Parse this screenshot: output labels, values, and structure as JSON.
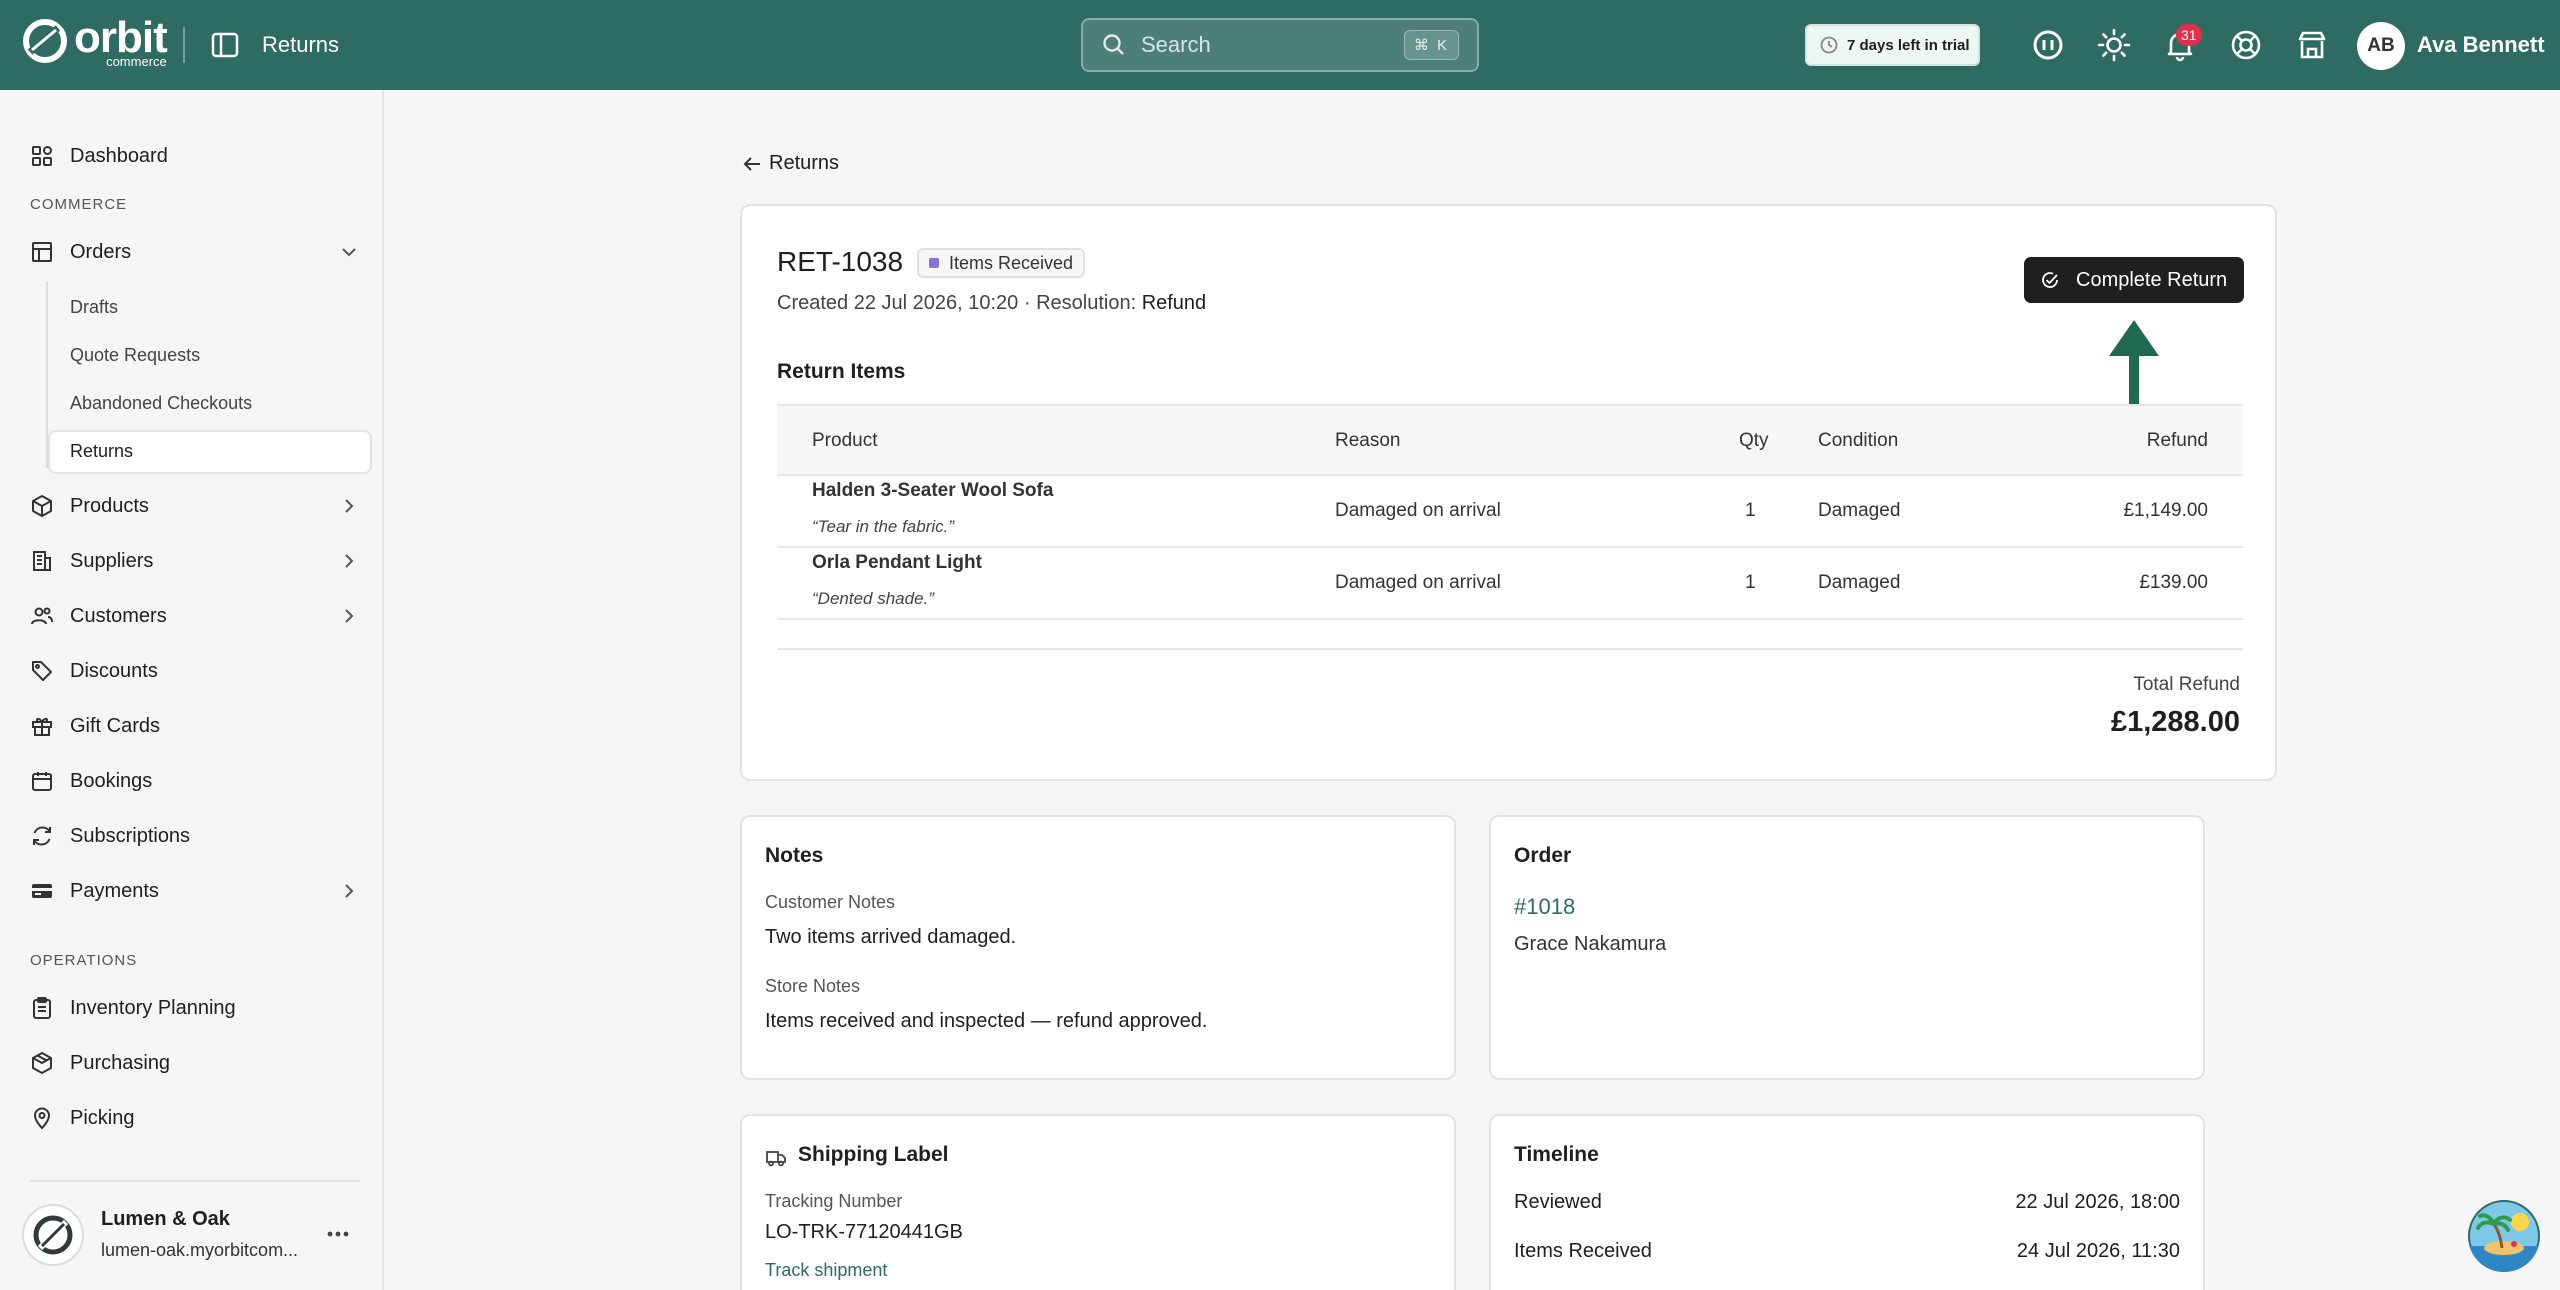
{
  "topbar": {
    "brand_name": "orbit",
    "brand_sub": "commerce",
    "page_title": "Returns",
    "search_placeholder": "Search",
    "search_shortcut": "⌘ K",
    "trial_text": "7 days left in trial",
    "notification_count": "31",
    "user_initials": "AB",
    "user_name": "Ava Bennett"
  },
  "sidebar": {
    "dashboard": "Dashboard",
    "commerce_label": "COMMERCE",
    "orders": "Orders",
    "orders_sub": [
      "Drafts",
      "Quote Requests",
      "Abandoned Checkouts",
      "Returns"
    ],
    "products": "Products",
    "suppliers": "Suppliers",
    "customers": "Customers",
    "discounts": "Discounts",
    "gift_cards": "Gift Cards",
    "bookings": "Bookings",
    "subscriptions": "Subscriptions",
    "payments": "Payments",
    "operations_label": "OPERATIONS",
    "inventory_planning": "Inventory Planning",
    "purchasing": "Purchasing",
    "picking": "Picking",
    "store_name": "Lumen & Oak",
    "store_url": "lumen-oak.myorbitcom..."
  },
  "main": {
    "back_label": "Returns",
    "return_id": "RET-1038",
    "status": "Items Received",
    "created_prefix": "Created 22 Jul 2026, 10:20 · Resolution: ",
    "resolution": "Refund",
    "complete_button": "Complete Return",
    "return_items_title": "Return Items",
    "columns": [
      "Product",
      "Reason",
      "Qty",
      "Condition",
      "Refund"
    ],
    "items": [
      {
        "product": "Halden 3-Seater Wool Sofa",
        "note": "“Tear in the fabric.”",
        "reason": "Damaged on arrival",
        "qty": "1",
        "condition": "Damaged",
        "refund": "£1,149.00"
      },
      {
        "product": "Orla Pendant Light",
        "note": "“Dented shade.”",
        "reason": "Damaged on arrival",
        "qty": "1",
        "condition": "Damaged",
        "refund": "£139.00"
      }
    ],
    "total_label": "Total Refund",
    "total_value": "£1,288.00"
  },
  "notes": {
    "title": "Notes",
    "customer_label": "Customer Notes",
    "customer_value": "Two items arrived damaged.",
    "store_label": "Store Notes",
    "store_value": "Items received and inspected — refund approved."
  },
  "order": {
    "title": "Order",
    "order_number": "#1018",
    "customer": "Grace Nakamura"
  },
  "shipping": {
    "title": "Shipping Label",
    "tracking_label": "Tracking Number",
    "tracking_value": "LO-TRK-77120441GB",
    "track_link": "Track shipment"
  },
  "timeline": {
    "title": "Timeline",
    "events": [
      {
        "label": "Reviewed",
        "date": "22 Jul 2026, 18:00"
      },
      {
        "label": "Items Received",
        "date": "24 Jul 2026, 11:30"
      }
    ]
  },
  "colors": {
    "brand": "#2e6b62",
    "status_dot": "#8b6fd8",
    "badge": "#e0314b"
  }
}
